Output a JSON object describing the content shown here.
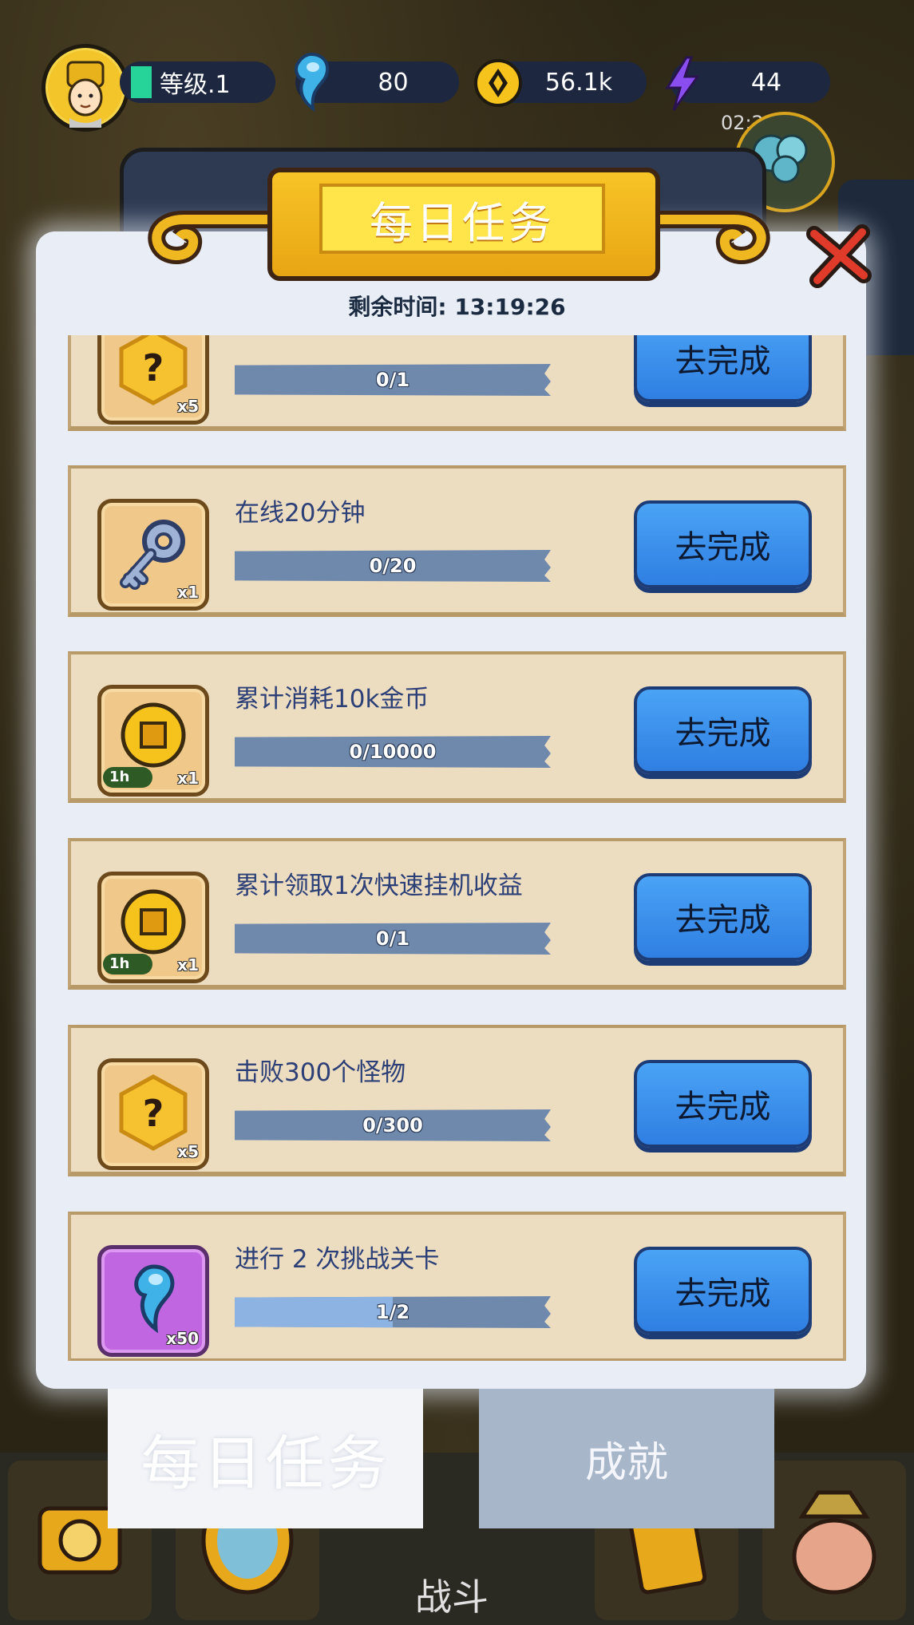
{
  "hud": {
    "level": "等级.1",
    "gems": "80",
    "gold": "56.1k",
    "energy": "44",
    "timer": "02:23"
  },
  "panel": {
    "title": "每日任务",
    "remaining": "剩余时间: 13:19:26"
  },
  "tasks": [
    {
      "title": "",
      "progress": "0/1",
      "fraction": 0,
      "reward_qty": "x5",
      "reward_icon": "mystery-box-icon",
      "button": "去完成"
    },
    {
      "title": "在线20分钟",
      "progress": "0/20",
      "fraction": 0,
      "reward_qty": "x1",
      "reward_icon": "key-icon",
      "button": "去完成"
    },
    {
      "title": "累计消耗10k金币",
      "progress": "0/10000",
      "fraction": 0,
      "reward_qty": "x1",
      "reward_tag": "1h",
      "reward_icon": "gold-coin-icon",
      "button": "去完成"
    },
    {
      "title": "累计领取1次快速挂机收益",
      "progress": "0/1",
      "fraction": 0,
      "reward_qty": "x1",
      "reward_tag": "1h",
      "reward_icon": "gold-coin-icon",
      "button": "去完成"
    },
    {
      "title": "击败300个怪物",
      "progress": "0/300",
      "fraction": 0,
      "reward_qty": "x5",
      "reward_icon": "mystery-box-icon",
      "button": "去完成"
    },
    {
      "title": "进行 2 次挑战关卡",
      "progress": "1/2",
      "fraction": 0.5,
      "reward_qty": "x50",
      "reward_icon": "soul-gem-icon",
      "button": "去完成"
    }
  ],
  "tabs": {
    "daily": "每日任务",
    "achievements": "成就"
  },
  "nav": {
    "battle": "战斗"
  },
  "colors": {
    "button_blue": "#3a8ff0",
    "progress_bg": "#6f89ad",
    "progress_fill": "#8cb3e2",
    "title_text": "#2c3f77"
  }
}
